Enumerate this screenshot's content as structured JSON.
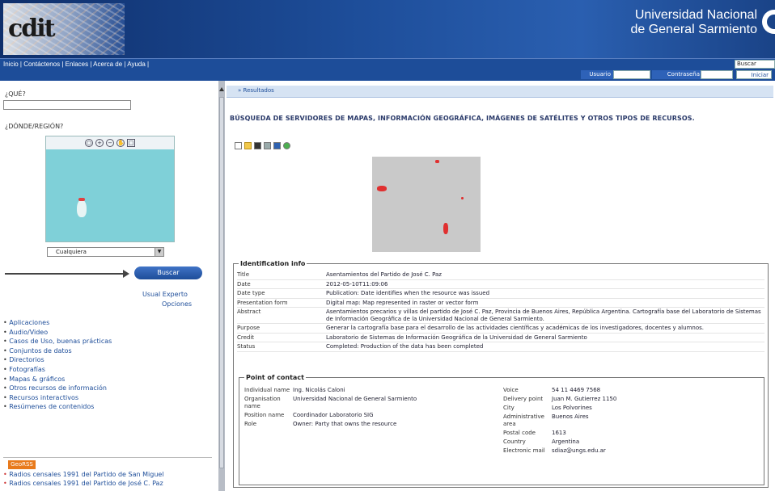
{
  "header": {
    "logo_text": "cdit",
    "university_line1": "Universidad Nacional",
    "university_line2": "de General Sarmiento"
  },
  "nav": {
    "links": "Inicio | Contáctenos | Enlaces | Acerca de | Ayuda |",
    "top_input": "Buscar",
    "user_label": "Usuario",
    "password_label": "Contraseña",
    "login_label": "Iniciar Sesión"
  },
  "sidebar": {
    "what_label": "¿QUÉ?",
    "where_label": "¿DÓNDE/REGIÓN?",
    "region_select": "Cualquiera",
    "search_button": "Buscar",
    "mode_simple": "Usual",
    "mode_expert": "Experto",
    "options_link": "Opciones",
    "categories": [
      "Aplicaciones",
      "Audio/Video",
      "Casos de Uso, buenas prácticas",
      "Conjuntos de datos",
      "Directorios",
      "Fotografías",
      "Mapas & gráficos",
      "Otros recursos de información",
      "Recursos interactivos",
      "Resúmenes de contenidos"
    ],
    "rss_badge": "GeoRSS",
    "rss_items": [
      "Radios censales 1991 del Partido de San Miguel",
      "Radios censales 1991 del Partido de José C. Paz"
    ]
  },
  "main": {
    "results_label": "Resultados",
    "page_title": "BÚSQUEDA DE SERVIDORES DE MAPAS, INFORMACIÓN GEOGRÁFICA, IMÁGENES DE SATÉLITES Y OTROS TIPOS DE RECURSOS.",
    "ident_title": "Identification info",
    "ident_rows": [
      {
        "key": "Title",
        "value": "Asentamientos del Partido de José C. Paz"
      },
      {
        "key": "Date",
        "value": "2012-05-10T11:09:06"
      },
      {
        "key": "Date type",
        "value": "Publication: Date identifies when the resource was issued"
      },
      {
        "key": "Presentation form",
        "value": "Digital map: Map represented in raster or vector form"
      },
      {
        "key": "Abstract",
        "value": "Asentamientos precarios y villas del partido de José C. Paz, Provincia de Buenos Aires, República Argentina. Cartografía base del Laboratorio de Sistemas de Información Geográfica de la Universidad Nacional de General Sarmiento."
      },
      {
        "key": "Purpose",
        "value": "Generar la cartografía base para el desarrollo de las actividades científicas y académicas de los investigadores, docentes y alumnos."
      },
      {
        "key": "Credit",
        "value": "Laboratorio de Sistemas de Información Geográfica de la Universidad de General Sarmiento"
      },
      {
        "key": "Status",
        "value": "Completed: Production of the data has been completed"
      }
    ],
    "contact_title": "Point of contact",
    "contact_left": [
      {
        "key": "Individual name",
        "value": "Ing. Nicolás Caloni"
      },
      {
        "key": "Organisation name",
        "value": "Universidad Nacional de General Sarmiento"
      },
      {
        "key": "Position name",
        "value": "Coordinador Laboratorio SIG"
      },
      {
        "key": "Role",
        "value": "Owner: Party that owns the resource"
      }
    ],
    "contact_right": [
      {
        "key": "Voice",
        "value": "54 11 4469 7568"
      },
      {
        "key": "Delivery point",
        "value": "Juan M. Gutierrez 1150"
      },
      {
        "key": "City",
        "value": "Los Polvorines"
      },
      {
        "key": "Administrative area",
        "value": "Buenos Aires"
      },
      {
        "key": "Postal code",
        "value": "1613"
      },
      {
        "key": "Country",
        "value": "Argentina"
      },
      {
        "key": "Electronic mail",
        "value": "sdiaz@ungs.edu.ar"
      }
    ]
  }
}
